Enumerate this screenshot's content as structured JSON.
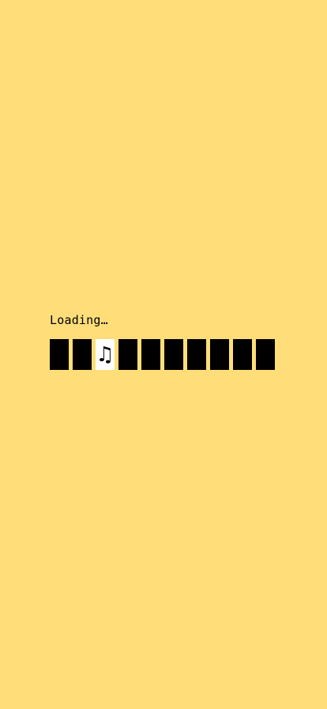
{
  "screen": {
    "background_color": "#FFDE7A"
  },
  "loader": {
    "label": "Loading…",
    "cell_count": 10,
    "active_index": 2,
    "active_symbol": "♫",
    "active_icon": "music-note-icon",
    "cell_color": "#000000",
    "active_cell_color": "#FFFFFF"
  }
}
